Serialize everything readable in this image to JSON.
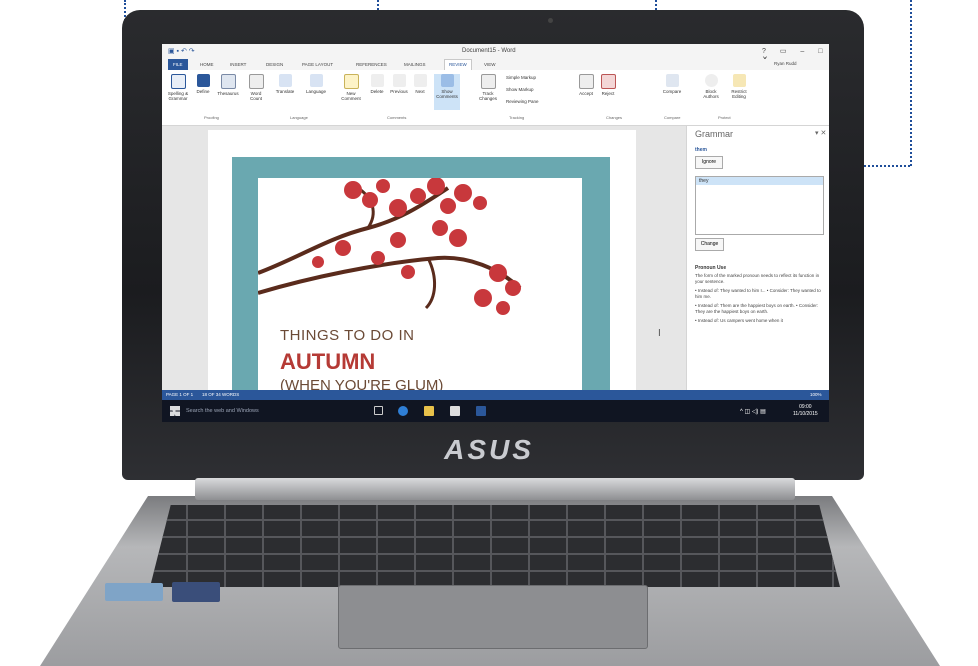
{
  "brand_logo": "ASUS",
  "window": {
    "title": "Document15 - Word",
    "controls": "? ▭ – □ ✕",
    "user": "Ryan Rudd"
  },
  "tabs": [
    "FILE",
    "HOME",
    "INSERT",
    "DESIGN",
    "PAGE LAYOUT",
    "REFERENCES",
    "MAILINGS",
    "REVIEW",
    "VIEW"
  ],
  "ribbon": {
    "buttons": [
      "Spelling & Grammar",
      "Define",
      "Thesaurus",
      "Word Count",
      "Translate",
      "Language",
      "New Comment",
      "Delete",
      "Previous",
      "Next",
      "Show Comments",
      "Track Changes",
      "Accept",
      "Reject",
      "Compare",
      "Block Authors",
      "Restrict Editing"
    ],
    "markup": [
      "Simple Markup",
      "Show Markup",
      "Reviewing Pane"
    ],
    "groups": [
      "Proofing",
      "Language",
      "Comments",
      "Tracking",
      "Changes",
      "Compare",
      "Protect"
    ]
  },
  "document": {
    "line1": "THINGS TO DO IN",
    "line2": "AUTUMN",
    "line3": "(WHEN YOU'RE GLUM)"
  },
  "grammar_pane": {
    "title": "Grammar",
    "word": "them",
    "ignore_label": "Ignore",
    "suggestion": "they",
    "change_label": "Change",
    "heading": "Pronoun Use",
    "body": [
      "The form of the marked pronoun needs to reflect its function in your sentence.",
      "• Instead of: They wanted to him I... • Consider: They wanted to him me.",
      "• Instead of: Them are the happiest boys on earth. • Consider: They are the happiest boys on earth.",
      "• Instead of: Us campers went home when it"
    ]
  },
  "status_bar": {
    "page": "PAGE 1 OF 1",
    "words": "18 OF 34 WORDS",
    "zoom": "100%"
  },
  "taskbar": {
    "search_placeholder": "Search the web and Windows",
    "time": "09:00",
    "date": "11/10/2015"
  },
  "colors": {
    "word_blue": "#2b579a",
    "flyer_teal": "#6aa8b0",
    "autumn_red": "#b53a35",
    "callout_dots": "#1f4e9a"
  }
}
